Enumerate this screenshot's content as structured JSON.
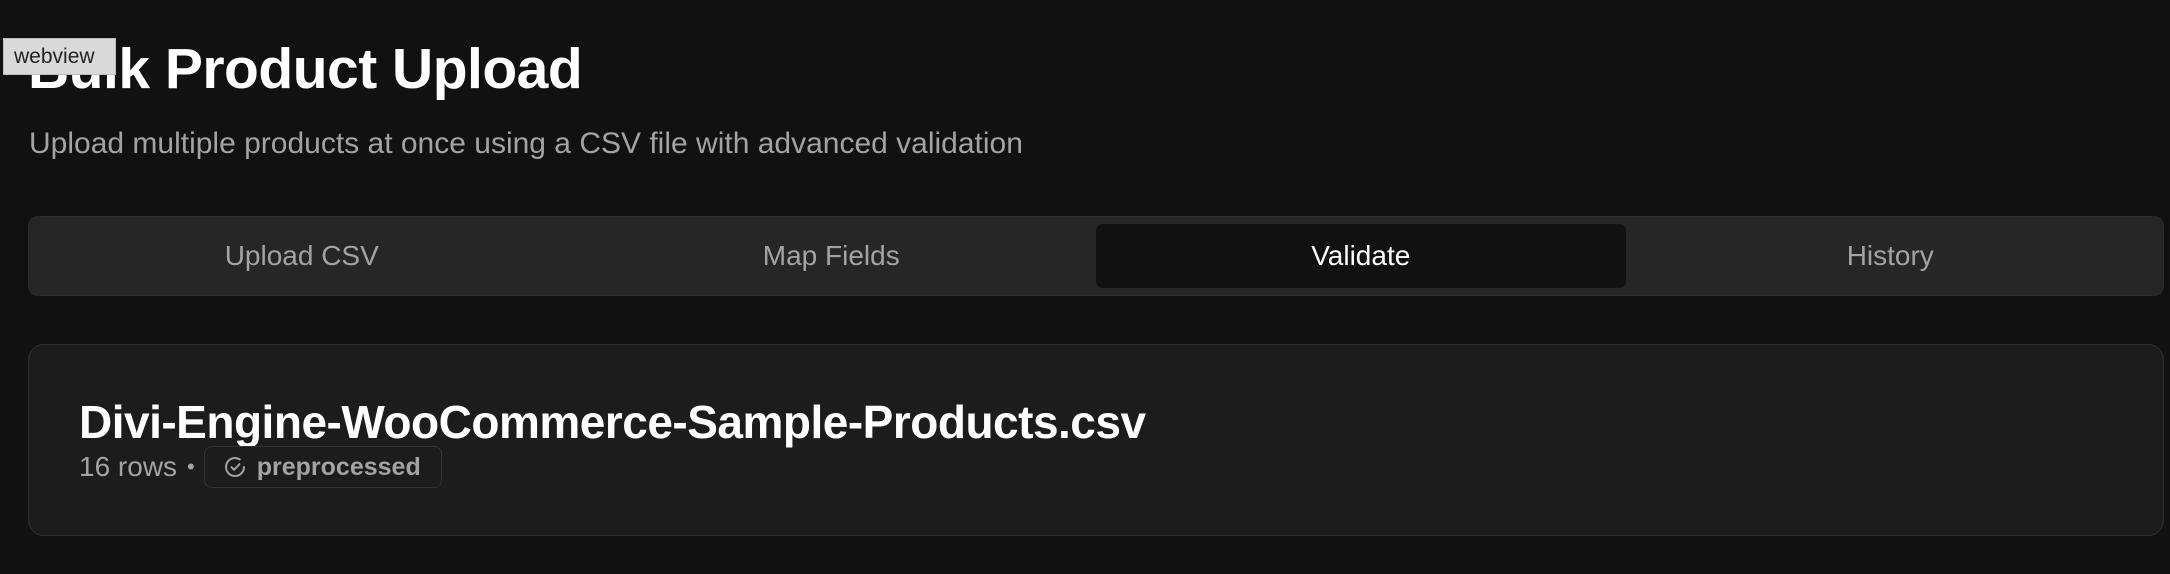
{
  "webview_tag": "webview",
  "header": {
    "title": "Bulk Product Upload",
    "subtitle": "Upload multiple products at once using a CSV file with advanced validation"
  },
  "tabs": [
    {
      "label": "Upload CSV",
      "active": false
    },
    {
      "label": "Map Fields",
      "active": false
    },
    {
      "label": "Validate",
      "active": true
    },
    {
      "label": "History",
      "active": false
    }
  ],
  "file": {
    "name": "Divi-Engine-WooCommerce-Sample-Products.csv",
    "rows": "16 rows",
    "separator": "•",
    "status": "preprocessed",
    "status_icon": "check-circle-icon"
  },
  "colors": {
    "background": "#111111",
    "tab_bar": "#262626",
    "card": "#1c1c1c",
    "muted_text": "#a3a3a3"
  }
}
